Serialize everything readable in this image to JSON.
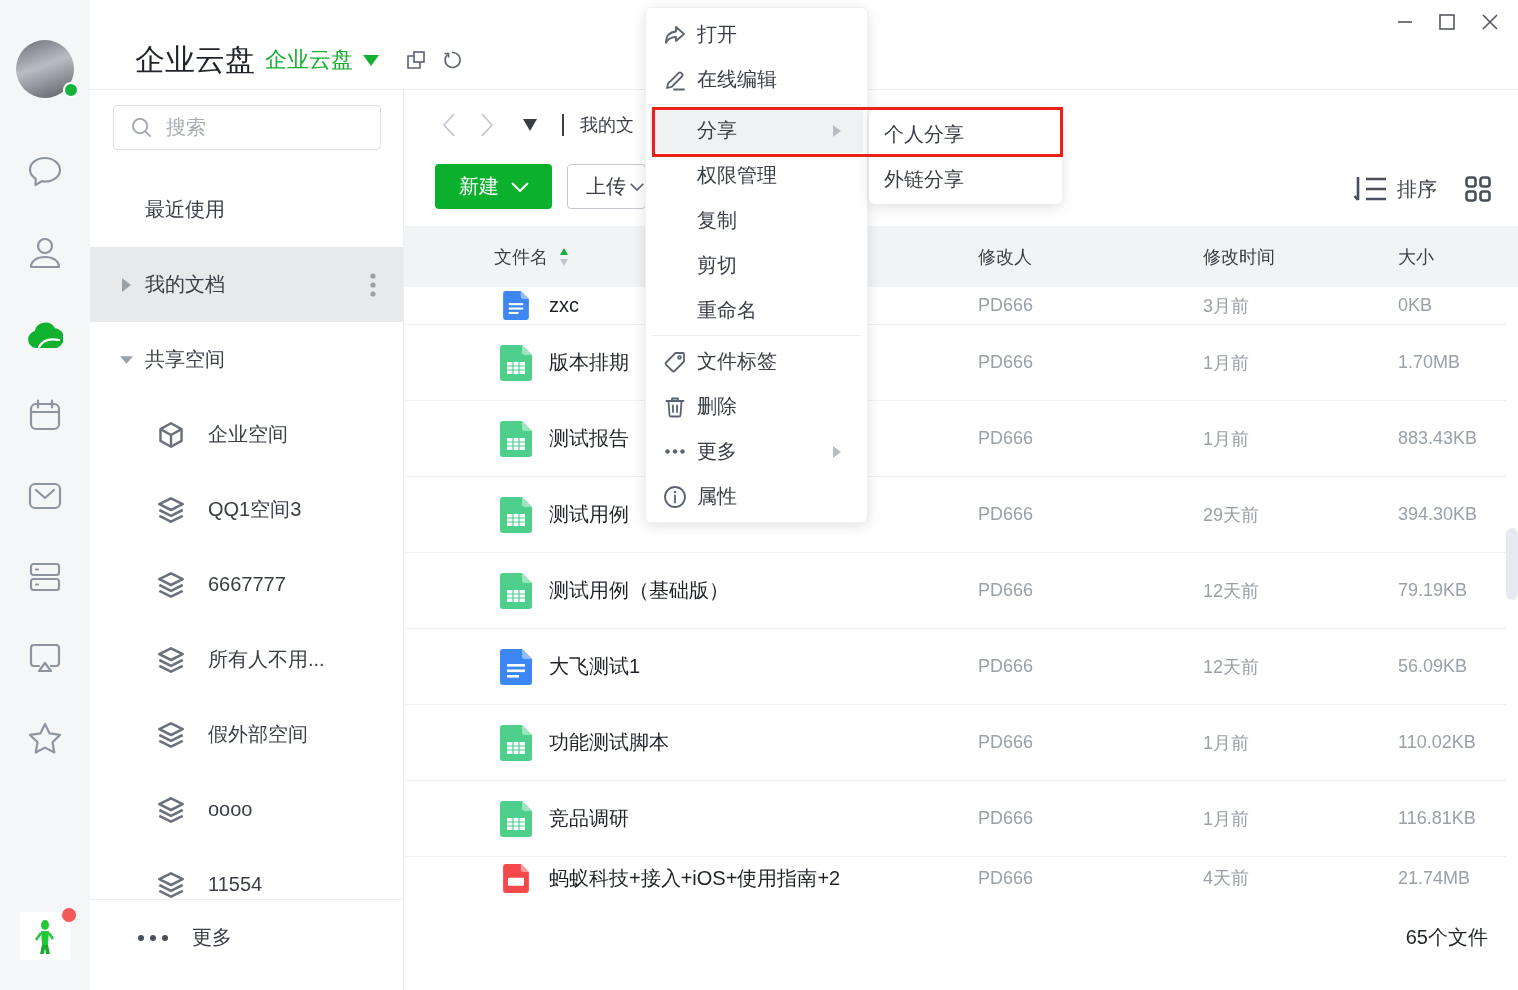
{
  "rail": {
    "avatar": {
      "online": true
    },
    "items": [
      {
        "selected": false
      },
      {
        "selected": false
      },
      {
        "selected": true
      },
      {
        "selected": false
      },
      {
        "selected": false
      },
      {
        "selected": false
      },
      {
        "selected": false
      },
      {
        "selected": false
      }
    ],
    "app": {
      "notification": true
    }
  },
  "header": {
    "title": "企业云盘",
    "space": "企业云盘"
  },
  "sidebar": {
    "search": {
      "placeholder": "搜索"
    },
    "recent": {
      "label": "最近使用",
      "selected": false
    },
    "tree": [
      {
        "label": "我的文档",
        "selected": true,
        "expanded": false
      },
      {
        "label": "共享空间",
        "selected": false,
        "expanded": true,
        "children": [
          {
            "label": "企业空间",
            "kind": "company",
            "selected": false
          },
          {
            "label": "QQ1空间3",
            "kind": "team",
            "selected": false
          },
          {
            "label": "6667777",
            "kind": "team",
            "selected": false
          },
          {
            "label": "所有人不用...",
            "kind": "team",
            "selected": false
          },
          {
            "label": "假外部空间",
            "kind": "team",
            "selected": false
          },
          {
            "label": "oooo",
            "kind": "team",
            "selected": false
          },
          {
            "label": "11554",
            "kind": "team",
            "selected": false
          }
        ]
      }
    ],
    "more": "更多"
  },
  "toolbar": {
    "breadcrumb": "我的文",
    "new_button": "新建",
    "upload_button": "上传",
    "sort_button": "排序"
  },
  "table": {
    "columns": [
      {
        "label": "文件名",
        "sorted": true,
        "ascending": true
      },
      {
        "label": "修改人",
        "sorted": false
      },
      {
        "label": "修改时间",
        "sorted": false
      },
      {
        "label": "大小",
        "sorted": false
      }
    ],
    "rows": [
      {
        "kind": "doc",
        "name": "zxc",
        "modifier": "PD666",
        "modified": "3月前",
        "size": "0KB"
      },
      {
        "kind": "sheet",
        "name": "版本排期",
        "modifier": "PD666",
        "modified": "1月前",
        "size": "1.70MB"
      },
      {
        "kind": "sheet",
        "name": "测试报告",
        "modifier": "PD666",
        "modified": "1月前",
        "size": "883.43KB"
      },
      {
        "kind": "sheet",
        "name": "测试用例",
        "modifier": "PD666",
        "modified": "29天前",
        "size": "394.30KB"
      },
      {
        "kind": "sheet",
        "name": "测试用例（基础版）",
        "modifier": "PD666",
        "modified": "12天前",
        "size": "79.19KB"
      },
      {
        "kind": "doc",
        "name": "大飞测试1",
        "modifier": "PD666",
        "modified": "12天前",
        "size": "56.09KB"
      },
      {
        "kind": "sheet",
        "name": "功能测试脚本",
        "modifier": "PD666",
        "modified": "1月前",
        "size": "110.02KB"
      },
      {
        "kind": "sheet",
        "name": "竞品调研",
        "modifier": "PD666",
        "modified": "1月前",
        "size": "116.81KB"
      },
      {
        "kind": "pdf",
        "name": "蚂蚁科技+接入+iOS+使用指南+2",
        "modifier": "PD666",
        "modified": "4天前",
        "size": "21.74MB"
      }
    ]
  },
  "status_bar": {
    "count": "65个文件"
  },
  "context_menu": {
    "sections": [
      {
        "items": [
          {
            "label": "打开",
            "selected": false,
            "submenu": false
          },
          {
            "label": "在线编辑",
            "selected": false,
            "submenu": false
          }
        ]
      },
      {
        "items": [
          {
            "label": "分享",
            "selected": true,
            "submenu": true
          },
          {
            "label": "权限管理",
            "selected": false,
            "submenu": false
          },
          {
            "label": "复制",
            "selected": false,
            "submenu": false
          },
          {
            "label": "剪切",
            "selected": false,
            "submenu": false
          },
          {
            "label": "重命名",
            "selected": false,
            "submenu": false
          }
        ]
      },
      {
        "items": [
          {
            "label": "文件标签",
            "selected": false,
            "submenu": false
          },
          {
            "label": "删除",
            "selected": false,
            "submenu": false
          },
          {
            "label": "更多",
            "selected": false,
            "submenu": true
          },
          {
            "label": "属性",
            "selected": false,
            "submenu": false
          }
        ]
      }
    ],
    "submenu": {
      "items": [
        {
          "label": "个人分享",
          "selected": false
        },
        {
          "label": "外链分享",
          "selected": false
        }
      ]
    }
  }
}
